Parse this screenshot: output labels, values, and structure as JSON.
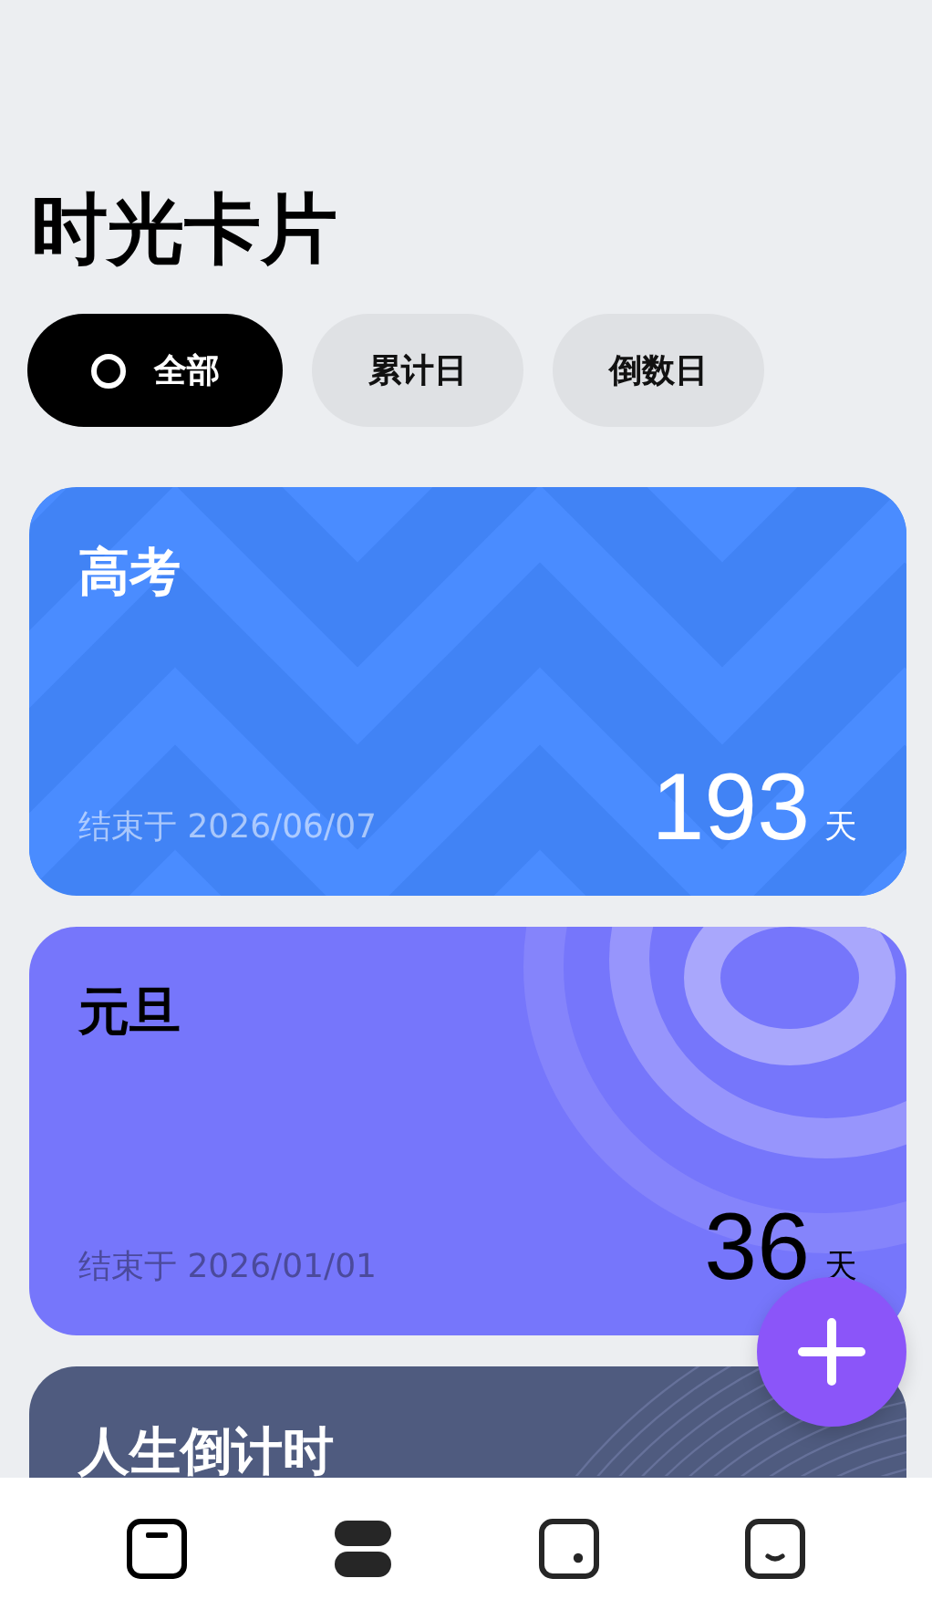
{
  "title": "时光卡片",
  "filters": [
    {
      "label": "全部",
      "selected": true
    },
    {
      "label": "累计日",
      "selected": false
    },
    {
      "label": "倒数日",
      "selected": false
    }
  ],
  "cards": [
    {
      "kind": "zigzag",
      "dark_title": false,
      "title": "高考",
      "end_label": "结束于 2026/06/07",
      "days": "193",
      "unit": "天"
    },
    {
      "kind": "rings",
      "dark_title": true,
      "title": "元旦",
      "end_label": "结束于 2026/01/01",
      "days": "36",
      "unit": "天"
    },
    {
      "kind": "lines",
      "dark_title": false,
      "title": "人生倒计时"
    }
  ],
  "nav": [
    {
      "selected": false
    },
    {
      "selected": true
    },
    {
      "selected": false
    },
    {
      "selected": false
    }
  ]
}
